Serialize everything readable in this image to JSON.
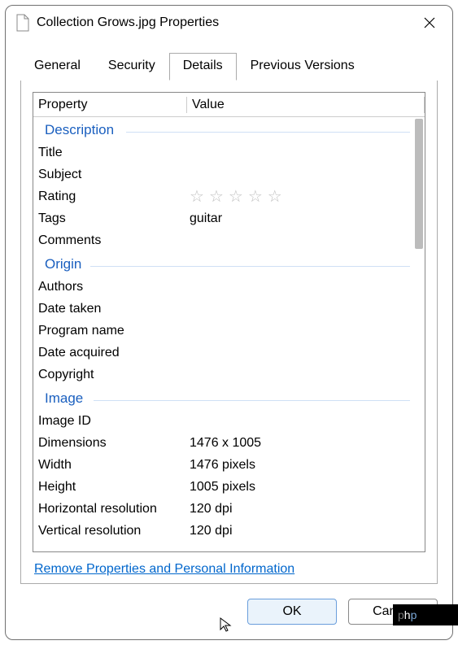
{
  "window": {
    "title": "Collection Grows.jpg Properties"
  },
  "tabs": [
    "General",
    "Security",
    "Details",
    "Previous Versions"
  ],
  "active_tab": "Details",
  "columns": {
    "property": "Property",
    "value": "Value"
  },
  "sections": {
    "description": {
      "label": "Description",
      "title": {
        "name": "Title",
        "value": ""
      },
      "subject": {
        "name": "Subject",
        "value": ""
      },
      "rating": {
        "name": "Rating",
        "stars": 5,
        "filled": 0
      },
      "tags": {
        "name": "Tags",
        "value": "guitar"
      },
      "comments": {
        "name": "Comments",
        "value": ""
      }
    },
    "origin": {
      "label": "Origin",
      "authors": {
        "name": "Authors",
        "value": ""
      },
      "date_taken": {
        "name": "Date taken",
        "value": ""
      },
      "program_name": {
        "name": "Program name",
        "value": ""
      },
      "date_acquired": {
        "name": "Date acquired",
        "value": ""
      },
      "copyright": {
        "name": "Copyright",
        "value": ""
      }
    },
    "image": {
      "label": "Image",
      "image_id": {
        "name": "Image ID",
        "value": ""
      },
      "dimensions": {
        "name": "Dimensions",
        "value": "1476 x 1005"
      },
      "width": {
        "name": "Width",
        "value": "1476 pixels"
      },
      "height": {
        "name": "Height",
        "value": "1005 pixels"
      },
      "h_res": {
        "name": "Horizontal resolution",
        "value": "120 dpi"
      },
      "v_res": {
        "name": "Vertical resolution",
        "value": "120 dpi"
      }
    }
  },
  "remove_link": "Remove Properties and Personal Information",
  "buttons": {
    "ok": "OK",
    "cancel": "Cancel"
  },
  "watermark": "php"
}
